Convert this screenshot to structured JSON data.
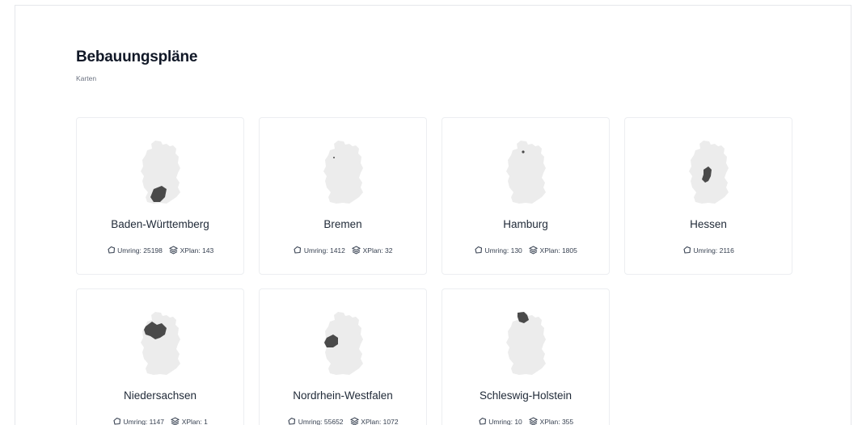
{
  "page": {
    "title": "Bebauungspläne",
    "subtitle": "Karten"
  },
  "colors": {
    "map_fill": "#ececec",
    "state_fill": "#4a4a4a",
    "card_border": "#eceef1"
  },
  "cards": [
    {
      "name": "Baden-Württemberg",
      "umring_label": "Umring: 25198",
      "xplan_label": "XPlan: 143",
      "region_icon": "baden-wuerttemberg-map-icon"
    },
    {
      "name": "Bremen",
      "umring_label": "Umring: 1412",
      "xplan_label": "XPlan: 32",
      "region_icon": "bremen-map-icon"
    },
    {
      "name": "Hamburg",
      "umring_label": "Umring: 130",
      "xplan_label": "XPlan: 1805",
      "region_icon": "hamburg-map-icon"
    },
    {
      "name": "Hessen",
      "umring_label": "Umring: 2116",
      "xplan_label": "",
      "region_icon": "hessen-map-icon"
    },
    {
      "name": "Niedersachsen",
      "umring_label": "Umring: 1147",
      "xplan_label": "XPlan: 1",
      "region_icon": "niedersachsen-map-icon"
    },
    {
      "name": "Nordrhein-Westfalen",
      "umring_label": "Umring: 55652",
      "xplan_label": "XPlan: 1072",
      "region_icon": "nordrhein-westfalen-map-icon"
    },
    {
      "name": "Schleswig-Holstein",
      "umring_label": "Umring: 10",
      "xplan_label": "XPlan: 355",
      "region_icon": "schleswig-holstein-map-icon"
    }
  ]
}
